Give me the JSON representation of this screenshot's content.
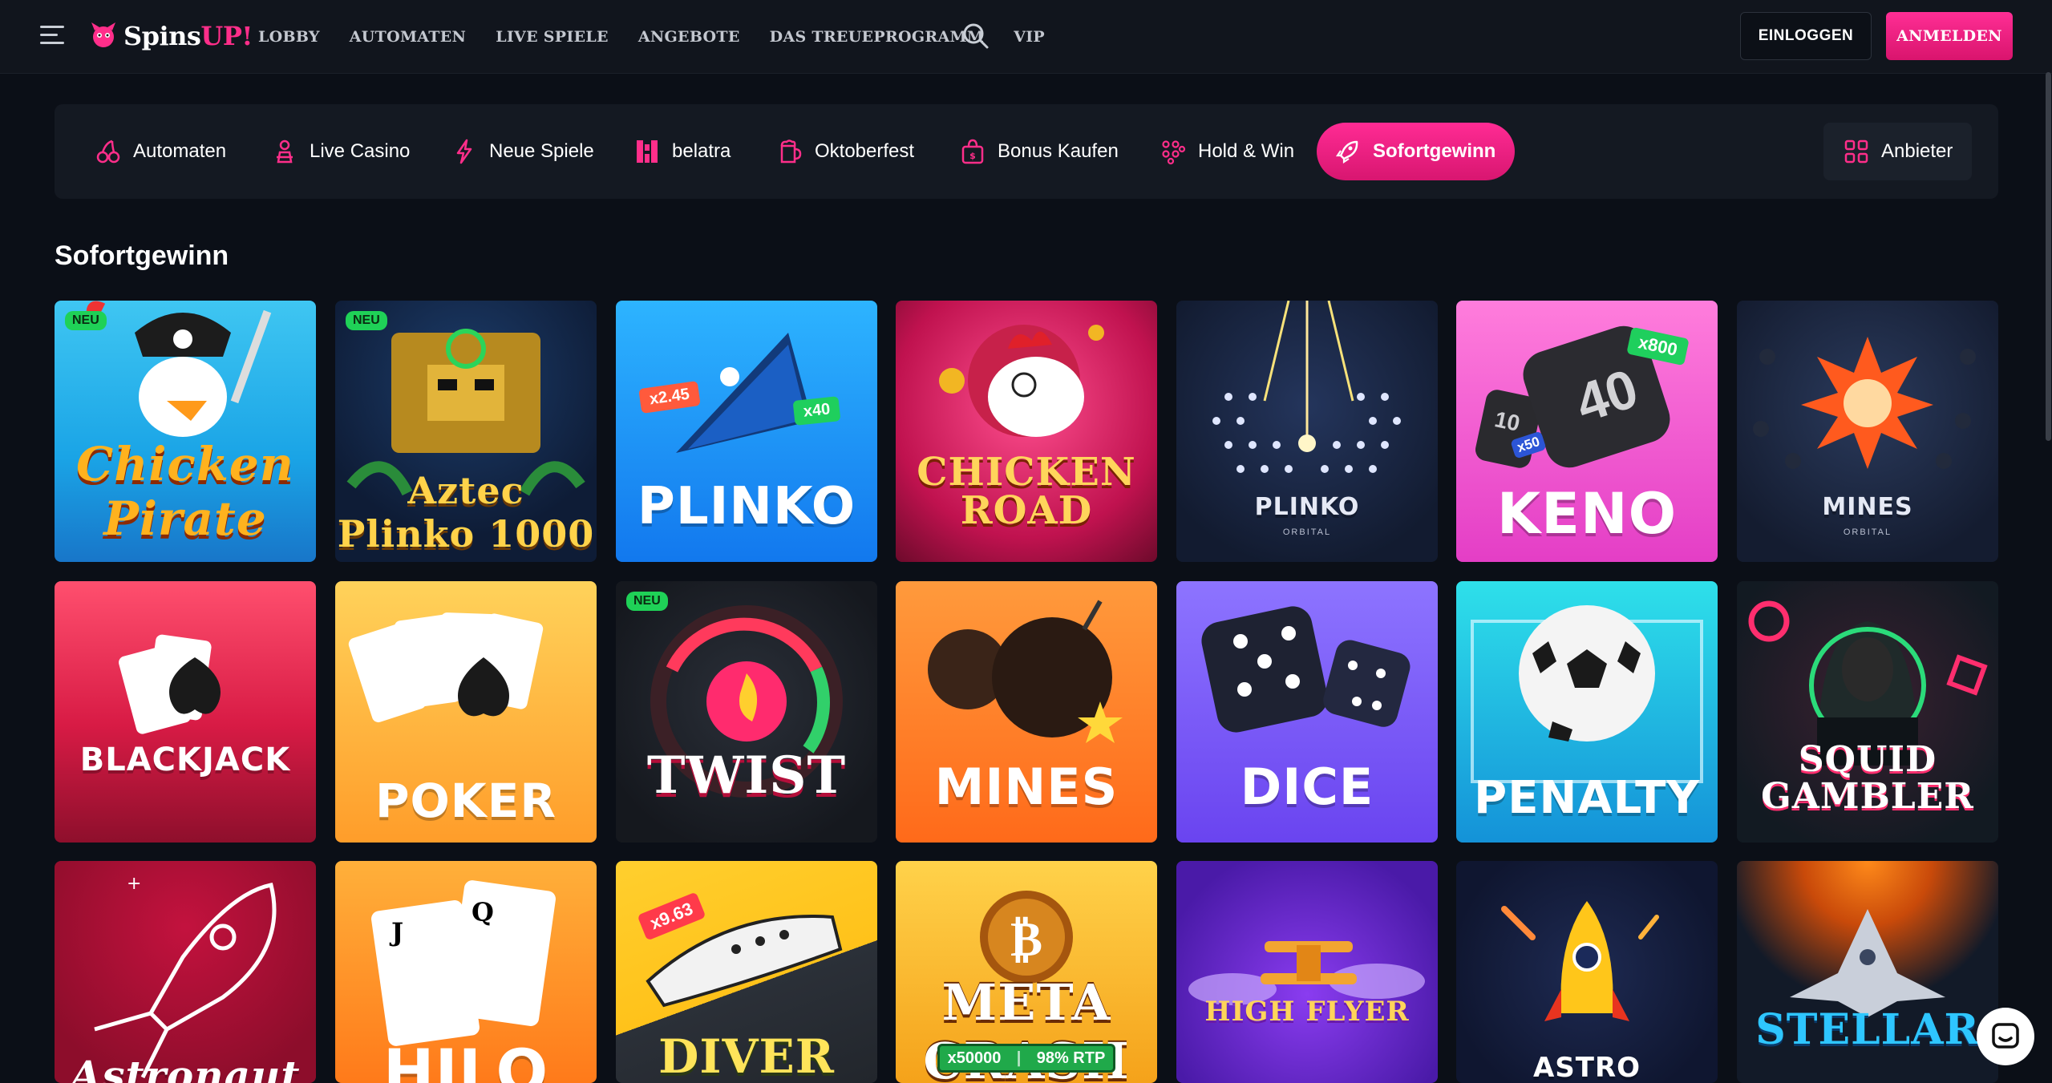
{
  "brand": {
    "name_main": "Spins",
    "name_accent": "UP!",
    "accent_color": "#ff2e8a"
  },
  "nav": {
    "links": [
      "LOBBY",
      "AUTOMATEN",
      "LIVE SPIELE",
      "ANGEBOTE",
      "DAS TREUEPROGRAMM",
      "VIP"
    ],
    "login_label": "EINLOGGEN",
    "signup_label": "ANMELDEN"
  },
  "categories": [
    {
      "label": "Automaten",
      "icon": "slot-cherries-icon"
    },
    {
      "label": "Live Casino",
      "icon": "live-dealer-icon"
    },
    {
      "label": "Neue Spiele",
      "icon": "lightning-icon"
    },
    {
      "label": "belatra",
      "icon": "belatra-logo-icon"
    },
    {
      "label": "Oktoberfest",
      "icon": "beer-mug-icon"
    },
    {
      "label": "Bonus Kaufen",
      "icon": "gift-bag-icon"
    },
    {
      "label": "Hold & Win",
      "icon": "dots-grid-icon"
    },
    {
      "label": "Sofortgewinn",
      "icon": "rocket-icon",
      "active": true
    }
  ],
  "provider_button": {
    "label": "Anbieter",
    "icon": "grid-icon"
  },
  "section": {
    "title": "Sofortgewinn"
  },
  "games": [
    {
      "title": "Chicken Pirate",
      "badge": "NEU"
    },
    {
      "title": "Aztec Plinko 1000",
      "badge": "NEU"
    },
    {
      "title": "PLINKO",
      "chips": [
        "x2.45",
        "x40"
      ]
    },
    {
      "title": "CHICKEN ROAD"
    },
    {
      "title": "PLINKO",
      "subtitle": "ORBITAL"
    },
    {
      "title": "KENO",
      "chips": [
        "x800",
        "x50"
      ],
      "dice_number": "40",
      "dice_number_small": "10"
    },
    {
      "title": "MINES",
      "subtitle": "ORBITAL"
    },
    {
      "title": "BLACKJACK"
    },
    {
      "title": "POKER"
    },
    {
      "title": "TWIST",
      "badge": "NEU"
    },
    {
      "title": "MINES"
    },
    {
      "title": "DICE"
    },
    {
      "title": "PENALTY"
    },
    {
      "title": "SQUID GAMBLER"
    },
    {
      "title": "Astronaut"
    },
    {
      "title": "HILO"
    },
    {
      "title": "DIVER",
      "chips": [
        "x9.63"
      ]
    },
    {
      "title": "META CRASH",
      "stats": [
        "x50000",
        "98% RTP"
      ]
    },
    {
      "title": "HIGH FLYER"
    },
    {
      "title": "ASTRO"
    },
    {
      "title": "STELLAR"
    }
  ]
}
